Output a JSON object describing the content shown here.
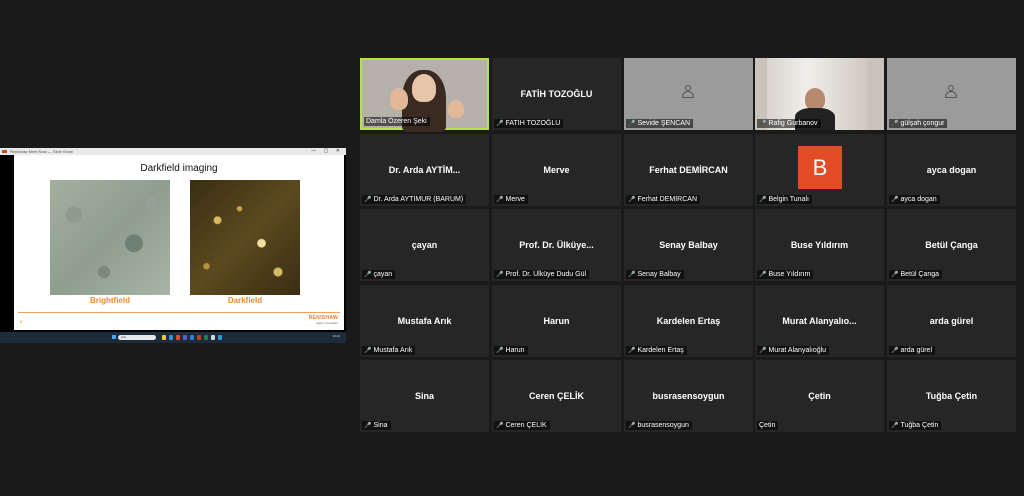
{
  "share": {
    "window_title": "Renishaw Meet Now — Slide Show",
    "window_buttons": "— ▢ ✕",
    "slide_title": "Darkfield imaging",
    "caption_left": "Brightfield",
    "caption_right": "Darkfield",
    "logo_brand": "RENISHAW",
    "logo_tagline": "apply innovation",
    "slide_number": "8",
    "taskbar": {
      "search_placeholder": "Ara",
      "clock": "10:24"
    }
  },
  "participants": [
    {
      "label": "Damla Özeren Şeki",
      "type": "video",
      "active": true,
      "muted": false
    },
    {
      "name": "FATİH TOZOĞLU",
      "label": "FATİH TOZOĞLU",
      "type": "name",
      "muted": true
    },
    {
      "label": "Sevide ŞENCAN",
      "type": "anon",
      "muted": true
    },
    {
      "label": "Rafig Gurbanov",
      "type": "video2",
      "muted": true
    },
    {
      "label": "gülşah çongur",
      "type": "anon",
      "muted": true
    },
    {
      "name": "Dr. Arda  AYTİM...",
      "label": "Dr. Arda AYTİMUR (BARUM)",
      "type": "name",
      "muted": true
    },
    {
      "name": "Merve",
      "label": "Merve",
      "type": "name",
      "muted": true
    },
    {
      "name": "Ferhat DEMİRCAN",
      "label": "Ferhat DEMİRCAN",
      "type": "name",
      "muted": true
    },
    {
      "label": "Belgin Tunalı",
      "avatar_letter": "B",
      "type": "avatar",
      "muted": true
    },
    {
      "name": "ayca dogan",
      "label": "ayca dogan",
      "type": "name",
      "muted": true
    },
    {
      "name": "çayan",
      "label": "çayan",
      "type": "name",
      "muted": true
    },
    {
      "name": "Prof. Dr. Ülküye...",
      "label": "Prof. Dr. Ülküye Dudu Gül",
      "type": "name",
      "muted": true
    },
    {
      "name": "Senay Balbay",
      "label": "Senay Balbay",
      "type": "name",
      "muted": true
    },
    {
      "name": "Buse Yıldırım",
      "label": "Buse Yıldırım",
      "type": "name",
      "muted": true
    },
    {
      "name": "Betül Çanga",
      "label": "Betül Çanga",
      "type": "name",
      "muted": true
    },
    {
      "name": "Mustafa Arık",
      "label": "Mustafa Arık",
      "type": "name",
      "muted": true
    },
    {
      "name": "Harun",
      "label": "Harun",
      "type": "name",
      "muted": true
    },
    {
      "name": "Kardelen Ertaş",
      "label": "Kardelen Ertaş",
      "type": "name",
      "muted": true
    },
    {
      "name": "Murat  Alanyalıo...",
      "label": "Murat Alanyalıoğlu",
      "type": "name",
      "muted": true
    },
    {
      "name": "arda gürel",
      "label": "arda gürel",
      "type": "name",
      "muted": true
    },
    {
      "name": "Sina",
      "label": "Sina",
      "type": "name",
      "muted": true
    },
    {
      "name": "Ceren ÇELİK",
      "label": "Ceren ÇELİK",
      "type": "name",
      "muted": true
    },
    {
      "name": "busrasensoygun",
      "label": "busrasensoygun",
      "type": "name",
      "muted": true
    },
    {
      "name": "Çetin",
      "label": "Çetin",
      "type": "name",
      "muted": false
    },
    {
      "name": "Tuğba Çetin",
      "label": "Tuğba Çetin",
      "type": "name",
      "muted": true
    }
  ],
  "colors": {
    "active_border": "#b7e04a",
    "mic_muted": "#e0373b",
    "avatar_bg": "#e24d28",
    "slide_accent": "#e98b2f"
  }
}
